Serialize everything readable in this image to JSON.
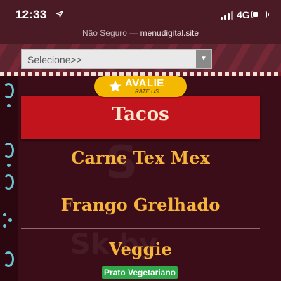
{
  "status_bar": {
    "time": "12:33",
    "network": "4G"
  },
  "url_bar": {
    "security": "Não Seguro —",
    "host": "menudigital.site"
  },
  "select": {
    "value": "Selecione>>",
    "arrow": "▼"
  },
  "rate_badge": {
    "label": "AVALIE",
    "sublabel": "RATE US",
    "icon": "star-icon"
  },
  "menu": {
    "active": "Tacos",
    "items": [
      {
        "label": "Carne Tex Mex"
      },
      {
        "label": "Frango Grelhado"
      },
      {
        "label": "Veggie",
        "badge": "Prato Vegetariano"
      }
    ]
  },
  "colors": {
    "active_bg": "#c2141c",
    "item_text": "#f6b53a",
    "badge_rate": "#f5b800",
    "badge_veg": "#2ea84a",
    "board_bg": "#3b0d18"
  }
}
